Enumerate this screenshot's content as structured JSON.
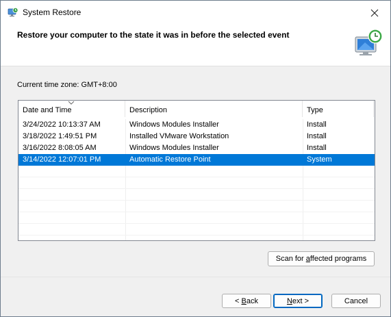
{
  "window": {
    "title": "System Restore",
    "icon": "system-restore-icon",
    "close_icon": "close-icon"
  },
  "header": {
    "heading": "Restore your computer to the state it was in before the selected event",
    "icon": "monitor-clock-restore-icon"
  },
  "timezone": "Current time zone: GMT+8:00",
  "table": {
    "columns": [
      "Date and Time",
      "Description",
      "Type"
    ],
    "sorted_column": "Date and Time",
    "rows": [
      {
        "date": "3/24/2022 10:13:37 AM",
        "description": "Windows Modules Installer",
        "type": "Install",
        "selected": false
      },
      {
        "date": "3/18/2022 1:49:51 PM",
        "description": "Installed VMware Workstation",
        "type": "Install",
        "selected": false
      },
      {
        "date": "3/16/2022 8:08:05 AM",
        "description": "Windows Modules Installer",
        "type": "Install",
        "selected": false
      },
      {
        "date": "3/14/2022 12:07:01 PM",
        "description": "Automatic Restore Point",
        "type": "System",
        "selected": true
      }
    ]
  },
  "buttons": {
    "scan_prefix": "Scan for ",
    "scan_accel": "a",
    "scan_suffix": "ffected programs",
    "back_prefix": "< ",
    "back_accel": "B",
    "back_suffix": "ack",
    "next_accel": "N",
    "next_suffix": "ext >",
    "cancel": "Cancel"
  },
  "colors": {
    "selection": "#0078d7",
    "default_button_border": "#0067c0",
    "window_bg": "#f0f0f0"
  }
}
